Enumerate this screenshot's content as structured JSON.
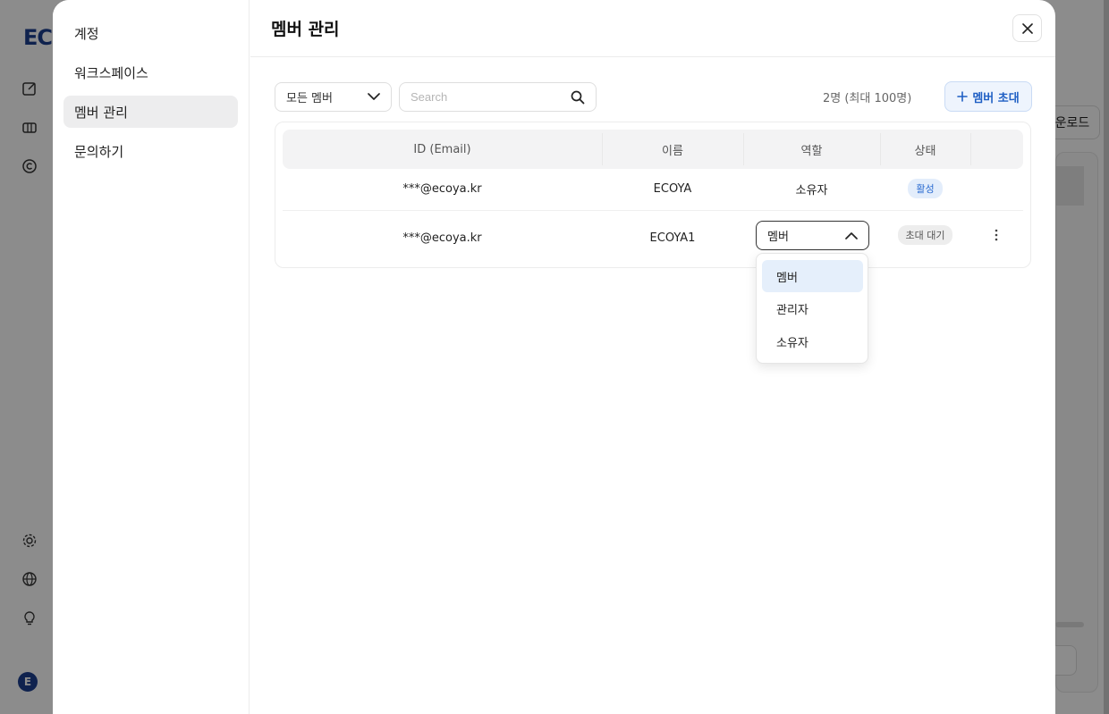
{
  "background": {
    "logo": "EC",
    "right_button_label": "운로드",
    "avatar_letter": "E"
  },
  "modal": {
    "sidebar": {
      "items": [
        {
          "label": "계정"
        },
        {
          "label": "워크스페이스"
        },
        {
          "label": "멤버 관리"
        },
        {
          "label": "문의하기"
        }
      ],
      "active_index": 2
    },
    "title": "멤버 관리",
    "filter": {
      "selected": "모든 멤버"
    },
    "search": {
      "placeholder": "Search",
      "value": ""
    },
    "member_count": "2명 (최대 100명)",
    "invite_button": {
      "icon": "plus-icon",
      "label": "멤버 초대"
    },
    "table": {
      "columns": [
        "ID (Email)",
        "이름",
        "역할",
        "상태"
      ],
      "rows": [
        {
          "email": "***@ecoya.kr",
          "name": "ECOYA",
          "role": "소유자",
          "status": "활성"
        },
        {
          "email": "***@ecoya.kr",
          "name": "ECOYA1",
          "role": "멤버",
          "status": "초대 대기"
        }
      ]
    },
    "role_dropdown": {
      "options": [
        "멤버",
        "관리자",
        "소유자"
      ],
      "selected": "멤버"
    }
  },
  "colors": {
    "accent": "#1f5fc4",
    "active_badge_bg": "#e3edfb",
    "selected_option_bg": "#e5effb"
  }
}
